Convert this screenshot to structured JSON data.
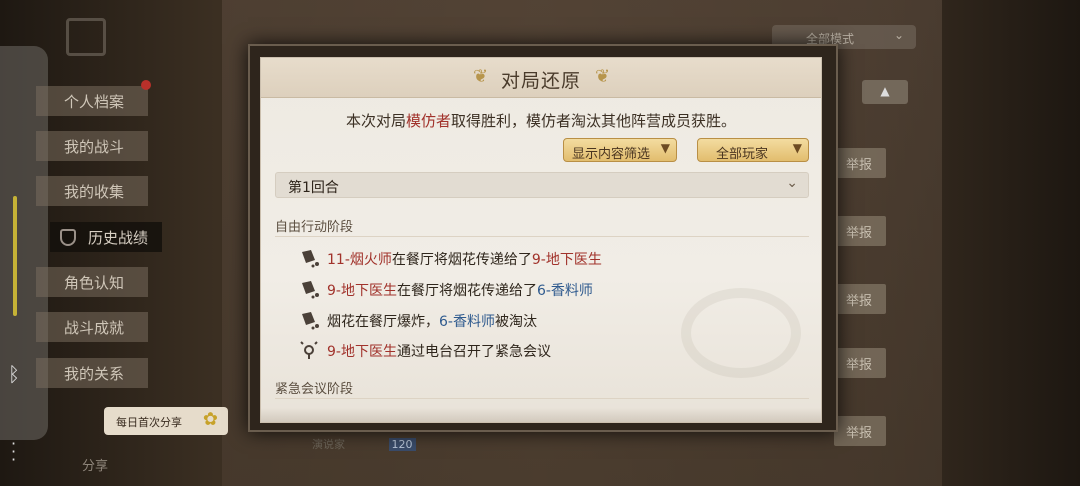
{
  "sidebar": {
    "items": [
      {
        "label": "个人档案"
      },
      {
        "label": "我的战斗"
      },
      {
        "label": "我的收集"
      },
      {
        "label": "历史战绩"
      },
      {
        "label": "角色认知"
      },
      {
        "label": "战斗成就"
      },
      {
        "label": "我的关系"
      }
    ],
    "share_bubble": "每日首次分享",
    "share_label": "分享"
  },
  "background": {
    "mode_select": "全部模式",
    "report_label": "举报",
    "bottom_text": "演说家   ",
    "bottom_badge": "120"
  },
  "modal": {
    "title": "对局还原",
    "summary": {
      "prefix": "本次对局",
      "winner": "模仿者",
      "suffix": "取得胜利，模仿者淘汰其他阵营成员获胜。"
    },
    "filter_content": "显示内容筛选",
    "filter_players": "全部玩家",
    "round_label": "第1回合",
    "phase_free": "自由行动阶段",
    "phase_meeting": "紧急会议阶段",
    "events": [
      {
        "a": "11-烟火师",
        "mid": "在餐厅将烟花传递给了",
        "b": "9-地下医生",
        "b_color": "red",
        "tail": ""
      },
      {
        "a": "9-地下医生",
        "mid": "在餐厅将烟花传递给了",
        "b": "6-香料师",
        "b_color": "blue",
        "tail": ""
      },
      {
        "a": "",
        "mid": "烟花在餐厅爆炸，",
        "b": "6-香料师",
        "b_color": "blue",
        "tail": "被淘汰"
      },
      {
        "a": "9-地下医生",
        "mid": "通过电台召开了紧急会议",
        "b": "",
        "b_color": "",
        "tail": ""
      }
    ]
  }
}
